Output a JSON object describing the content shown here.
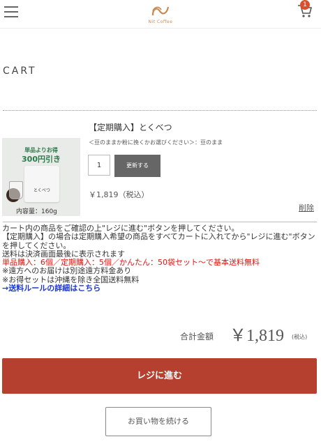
{
  "header": {
    "logo_sub": "Nit Coffee",
    "cart_count": "1",
    "icons": {
      "menu": "hamburger-icon",
      "cart": "cart-icon",
      "logo": "logo-icon"
    }
  },
  "page_title": "CART",
  "item": {
    "image": {
      "top_line1": "単品よりお得",
      "top_line2": "300円引き",
      "bag_label": "とくべつ",
      "bottom_text": "内容量：160g"
    },
    "name": "【定期購入】とくべつ",
    "option": "＜豆のままか粉に挽くかお選びください＞：豆のまま",
    "quantity": "1",
    "update_label": "更新する",
    "price": "￥1,819（税込）",
    "delete_label": "削除"
  },
  "notes": {
    "line1": "カート内の商品をご確認の上\"レジに進む\"ボタンを押してください。",
    "line2": "【定期購入】の場合は定期購入希望の商品をすべてカートに入れてから\"レジに進む\"ボタンを押してください。",
    "line3": "送料は決済画面最後に表示されます",
    "line4_red": "単品購入：6個／定期購入：5個／かんたん：50袋セット〜で基本送料無料",
    "line5": "※遠方へのお届けは別途遠方料金あり",
    "line6": "※お得セットは沖縄を除き全国送料無料",
    "link_blue": "→送料ルールの詳細はこちら"
  },
  "total": {
    "label": "合計金額",
    "value": "￥1,819",
    "tax": "(税込)"
  },
  "buttons": {
    "checkout": "レジに進む",
    "continue": "お買い物を続ける"
  },
  "colors": {
    "checkout_bg": "#b5402f",
    "badge": "#d9502f",
    "notice_red": "#e0140f",
    "link_blue": "#1a35d4",
    "logo": "#c98a52"
  }
}
